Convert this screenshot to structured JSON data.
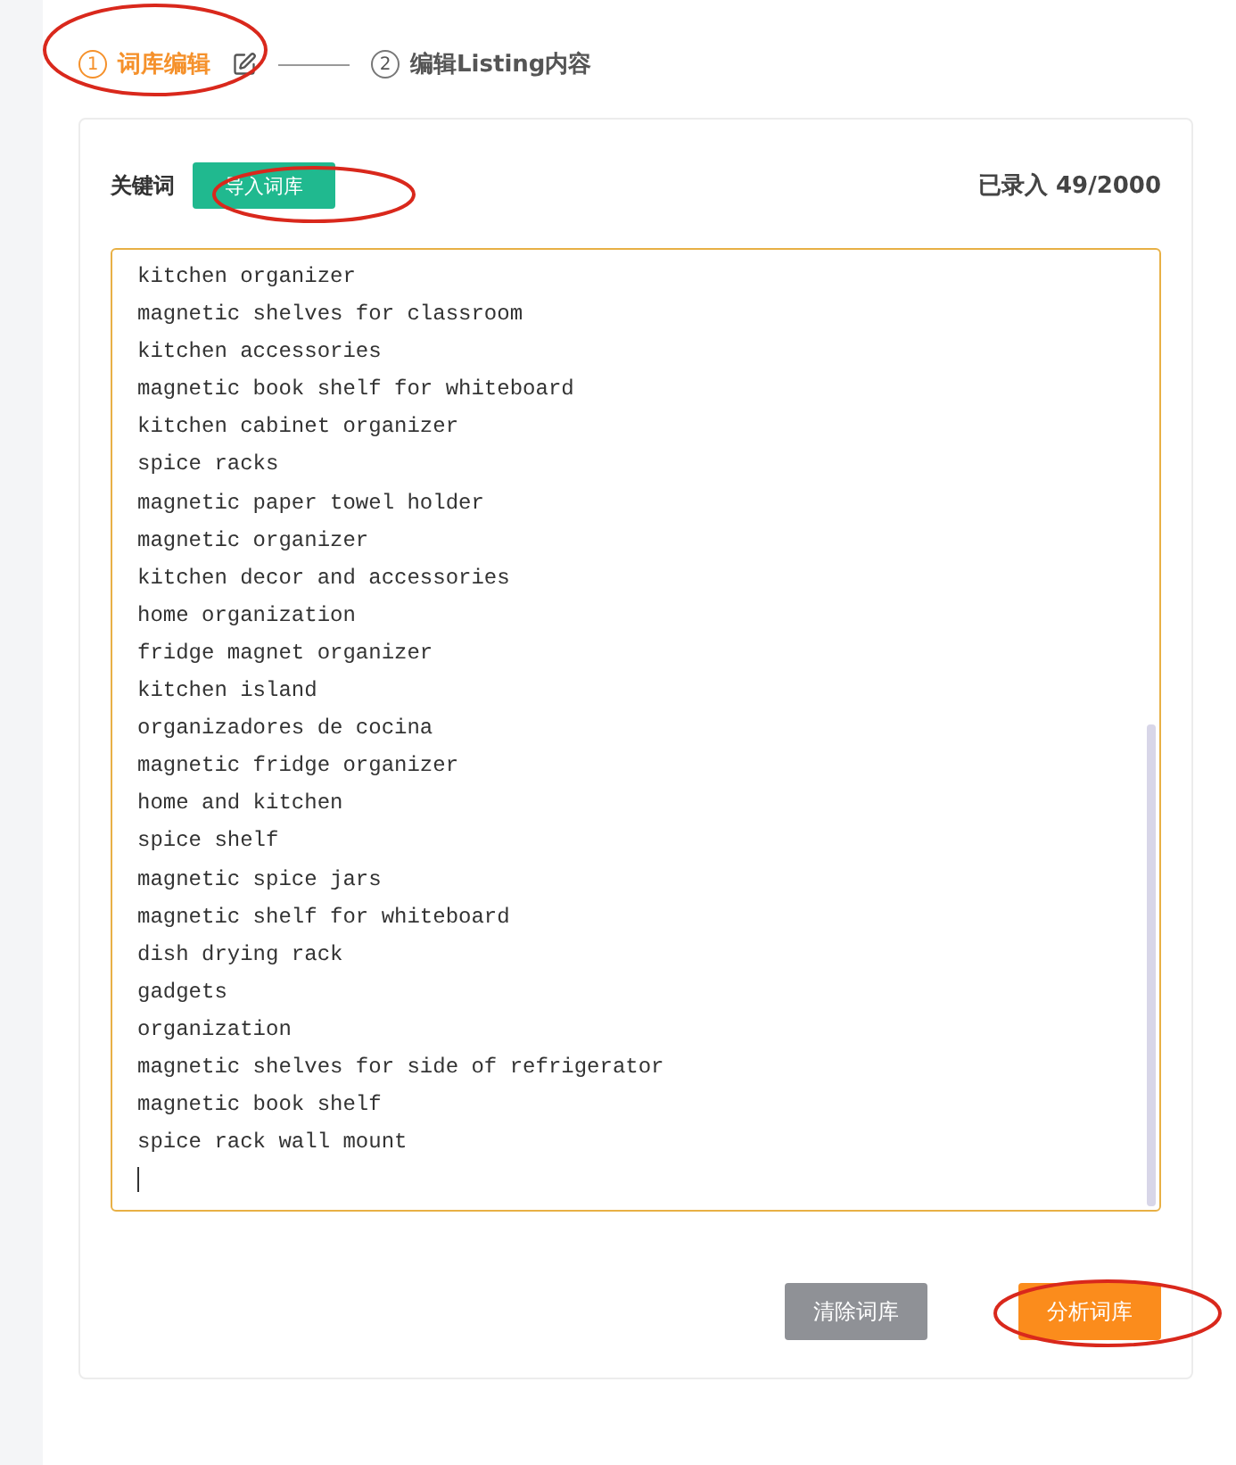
{
  "steps": [
    {
      "number": "1",
      "label": "词库编辑",
      "selected": true
    },
    {
      "number": "2",
      "label": "编辑Listing内容",
      "selected": false
    }
  ],
  "keyword_panel": {
    "label": "关键词",
    "import_button": "导入词库",
    "count": "已录入 49/2000",
    "keywords": [
      "kitchen organizer",
      "magnetic shelves for classroom",
      "kitchen accessories",
      "magnetic book shelf for whiteboard",
      "kitchen cabinet organizer",
      "spice racks",
      "magnetic paper towel holder",
      "magnetic organizer",
      "kitchen decor and accessories",
      "home organization",
      "fridge magnet organizer",
      "kitchen island",
      "organizadores de cocina",
      "magnetic fridge organizer",
      "home and kitchen",
      "spice shelf",
      "magnetic spice jars",
      "magnetic shelf for whiteboard",
      "dish drying rack",
      "gadgets",
      "organization",
      "magnetic shelves for side of refrigerator",
      "magnetic book shelf",
      "spice rack wall mount"
    ],
    "clear_button": "清除词库",
    "analyze_button": "分析词库"
  }
}
